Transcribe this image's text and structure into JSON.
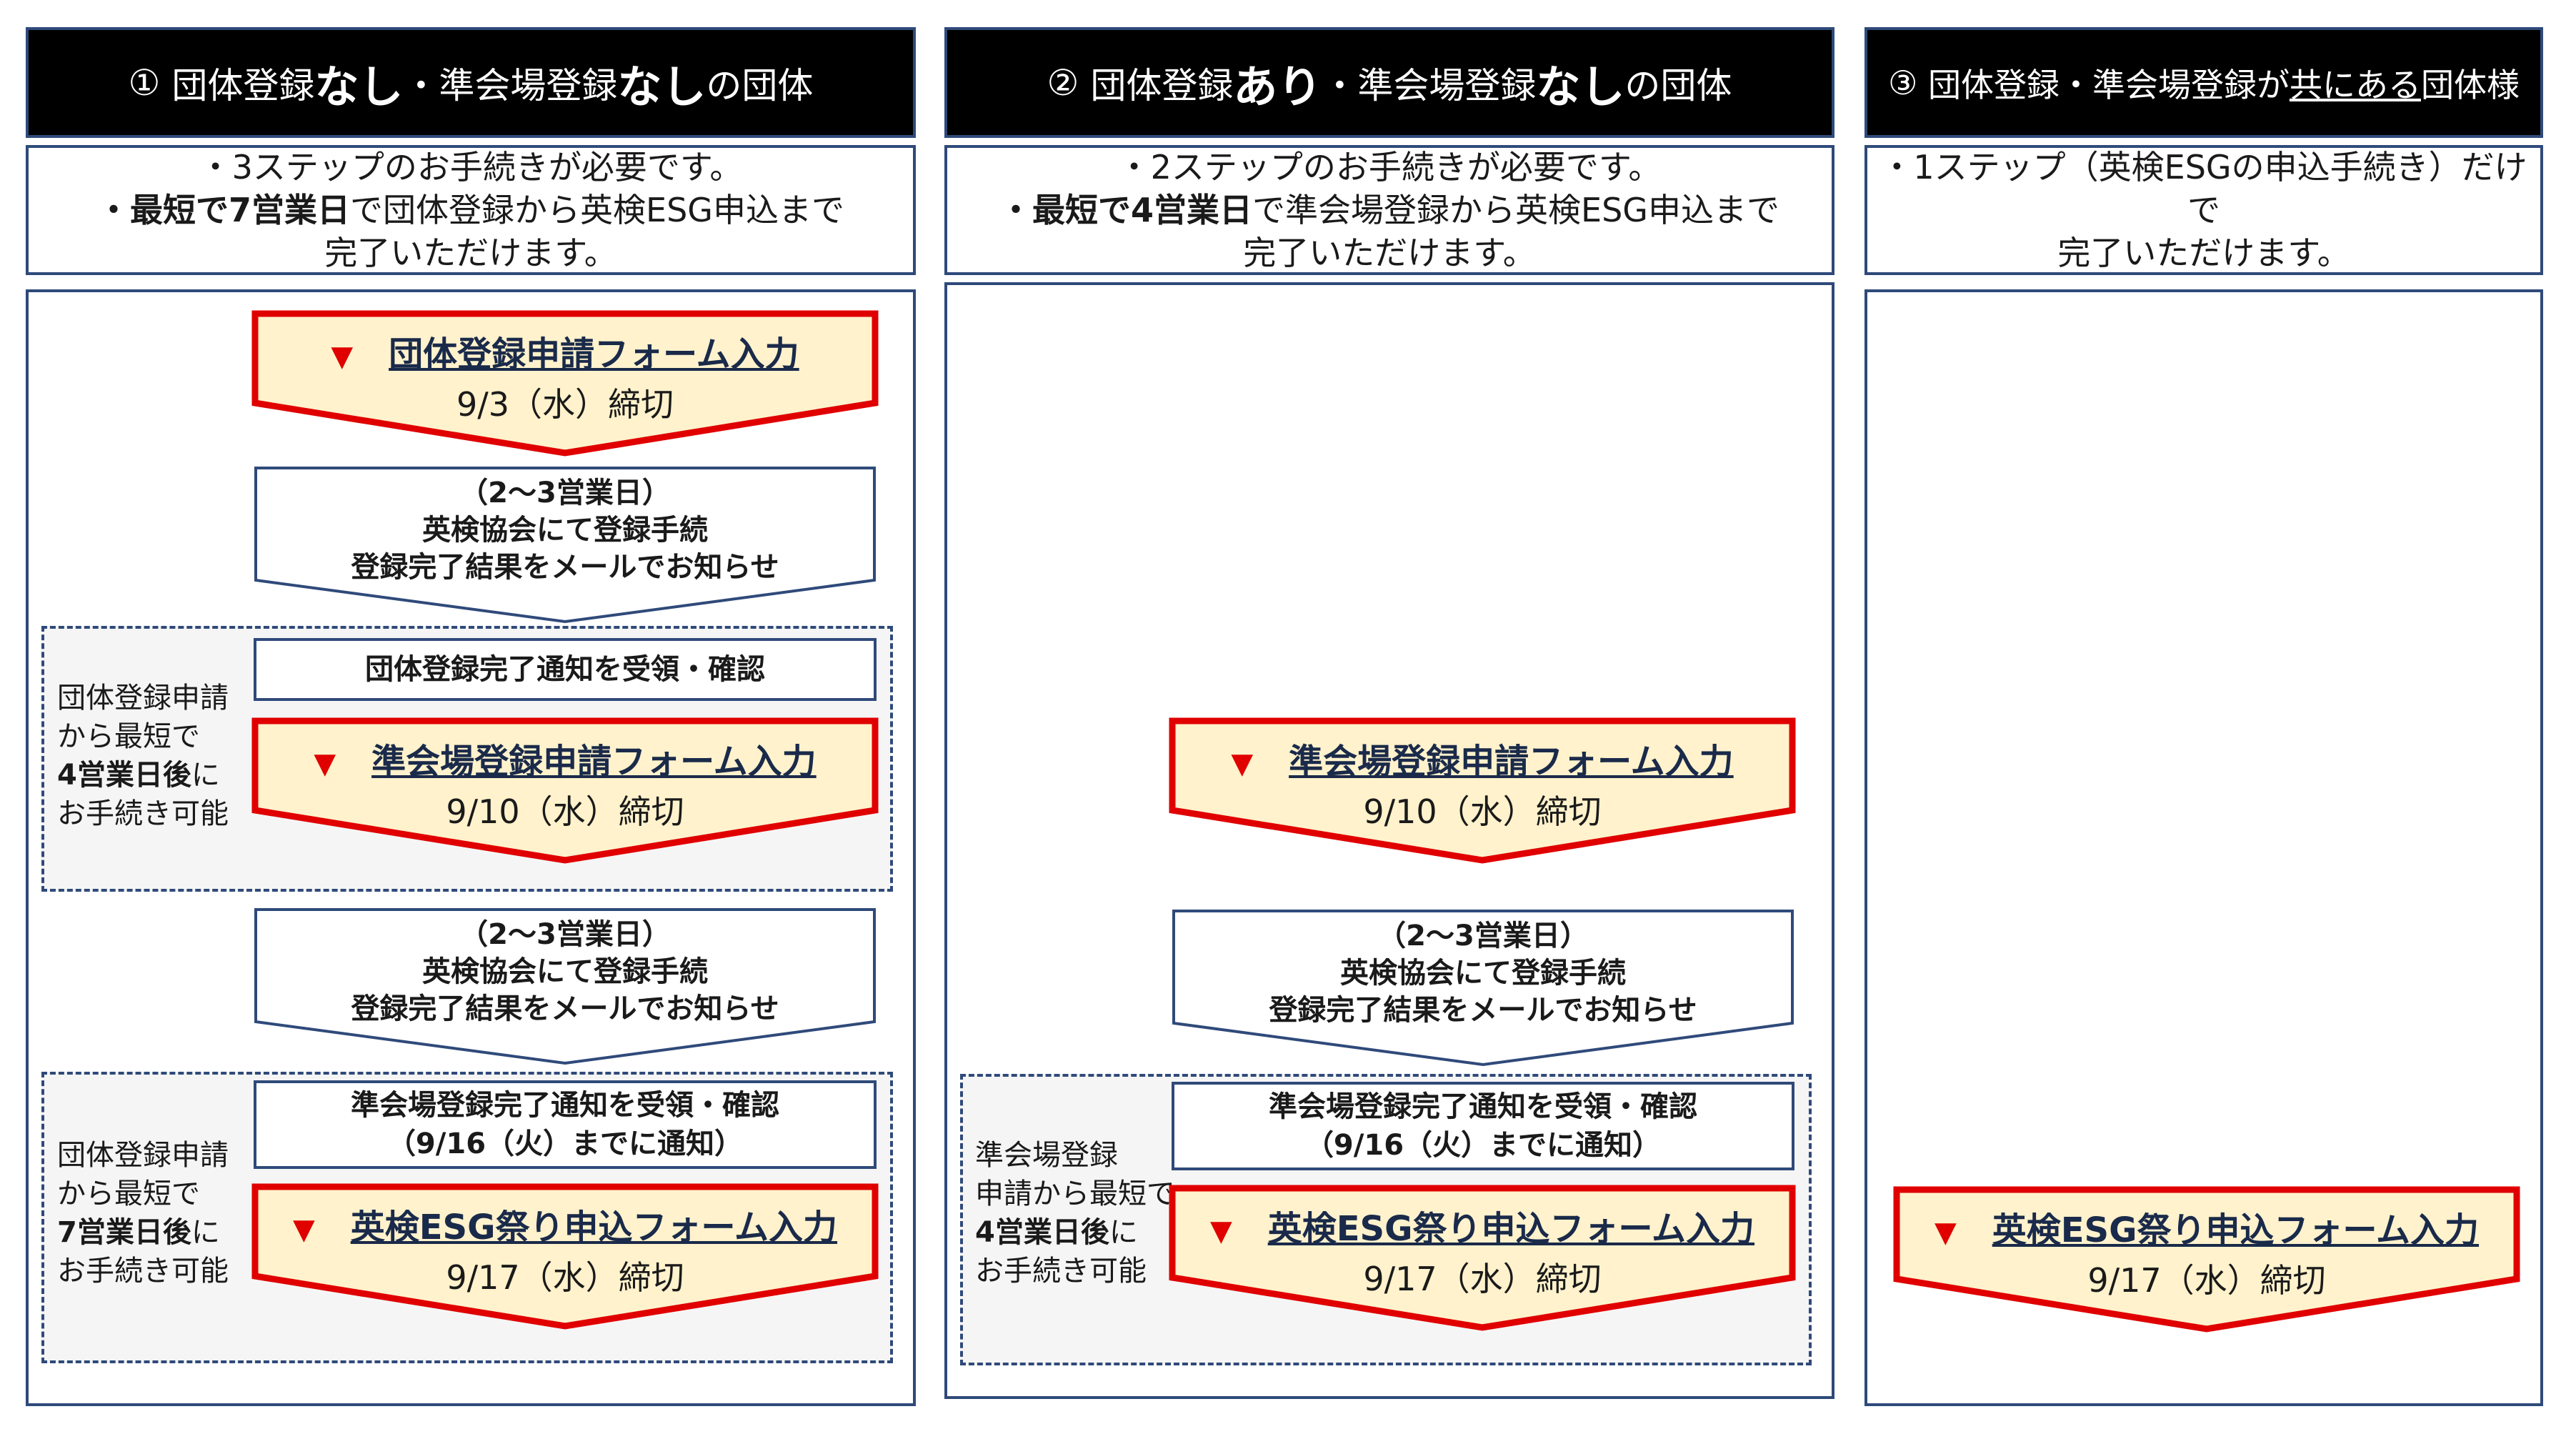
{
  "columns": [
    {
      "header": {
        "num": "①",
        "p1": "団体登録",
        "b1": "なし",
        "p2": "・準会場登録",
        "b2": "なし",
        "p3": "の団体"
      },
      "desc": {
        "line1": "・3ステップのお手続きが必要です。",
        "bold": "・最短で7営業日",
        "rest": "で団体登録から英検ESG申込まで",
        "line3": "完了いただけます。"
      }
    },
    {
      "header": {
        "num": "②",
        "p1": "団体登録",
        "b1": "あり",
        "p2": "・準会場登録",
        "b2": "なし",
        "p3": "の団体"
      },
      "desc": {
        "line1": "・2ステップのお手続きが必要です。",
        "bold": "・最短で4営業日",
        "rest": "で準会場登録から英検ESG申込まで",
        "line3": "完了いただけます。"
      }
    },
    {
      "header": {
        "num": "③",
        "p1": "団体登録・準会場登録が",
        "u1": "共にある",
        "p2": "団体様"
      },
      "desc": {
        "line1": "・1ステップ（英検ESGの申込手続き）だけで",
        "line2": "完了いただけます。"
      }
    }
  ],
  "forms": {
    "group_reg": {
      "marker": "▼",
      "title": "団体登録申請フォーム入力",
      "date": "9/3（水）締切"
    },
    "venue_reg": {
      "marker": "▼",
      "title": "準会場登録申請フォーム入力",
      "date": "9/10（水）締切"
    },
    "esg_apply": {
      "marker": "▼",
      "title": "英検ESG祭り申込フォーム入力",
      "date": "9/17（水）締切"
    }
  },
  "processing": {
    "line1": "（2～3営業日）",
    "line2": "英検協会にて登録手続",
    "line3": "登録完了結果をメールでお知らせ"
  },
  "notices": {
    "group_done": "団体登録完了通知を受領・確認",
    "venue_done_line1": "準会場登録完了通知を受領・確認",
    "venue_done_line2": "（9/16（火）までに通知）"
  },
  "side_notes": {
    "col1_a": {
      "line1": "団体登録申請",
      "line2": "から最短で",
      "bold": "4営業日後",
      "suffix": "に",
      "line4": "お手続き可能"
    },
    "col1_b": {
      "line1": "団体登録申請",
      "line2": "から最短で",
      "bold": "7営業日後",
      "suffix": "に",
      "line4": "お手続き可能"
    },
    "col2": {
      "line1": "準会場登録",
      "line2": "申請から最短で",
      "bold": "4営業日後",
      "suffix": "に",
      "line4": "お手続き可能"
    }
  },
  "colors": {
    "header_bg": "#000000",
    "border": "#2f4a7a",
    "form_fill": "#fff2cc",
    "form_border": "#e00000",
    "marker": "#e00000",
    "note_bg": "#f5f5f5"
  }
}
